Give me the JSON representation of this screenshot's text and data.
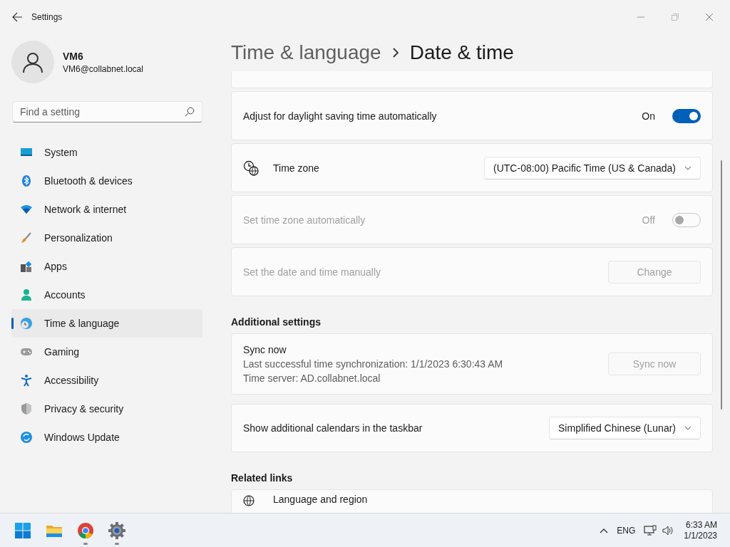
{
  "window": {
    "title": "Settings"
  },
  "account": {
    "name": "VM6",
    "email": "VM6@collabnet.local"
  },
  "search": {
    "placeholder": "Find a setting"
  },
  "nav": [
    {
      "label": "System",
      "kind": "system",
      "selected": false
    },
    {
      "label": "Bluetooth & devices",
      "kind": "bluetooth",
      "selected": false
    },
    {
      "label": "Network & internet",
      "kind": "network",
      "selected": false
    },
    {
      "label": "Personalization",
      "kind": "brush",
      "selected": false
    },
    {
      "label": "Apps",
      "kind": "apps",
      "selected": false
    },
    {
      "label": "Accounts",
      "kind": "accounts",
      "selected": false
    },
    {
      "label": "Time & language",
      "kind": "time",
      "selected": true
    },
    {
      "label": "Gaming",
      "kind": "gaming",
      "selected": false
    },
    {
      "label": "Accessibility",
      "kind": "accessibility",
      "selected": false
    },
    {
      "label": "Privacy & security",
      "kind": "privacy",
      "selected": false
    },
    {
      "label": "Windows Update",
      "kind": "update",
      "selected": false
    }
  ],
  "breadcrumb": {
    "parent": "Time & language",
    "current": "Date & time"
  },
  "settings": [
    {
      "kind": "toggle",
      "label": "Adjust for daylight saving time automatically",
      "state_label": "On",
      "on": true,
      "disabled": false
    },
    {
      "kind": "dropdown",
      "label": "Time zone",
      "value": "(UTC-08:00) Pacific Time (US & Canada)",
      "has_icon": true
    },
    {
      "kind": "toggle",
      "label": "Set time zone automatically",
      "state_label": "Off",
      "on": false,
      "disabled": true
    },
    {
      "kind": "button",
      "label": "Set the date and time manually",
      "button": "Change",
      "disabled": true
    }
  ],
  "additional_settings": {
    "heading": "Additional settings",
    "items": [
      {
        "kind": "sync",
        "title": "Sync now",
        "lines": [
          "Last successful time synchronization: 1/1/2023 6:30:43 AM",
          "Time server: AD.collabnet.local"
        ],
        "button": "Sync now",
        "disabled": true
      },
      {
        "kind": "dropdown",
        "label": "Show additional calendars in the taskbar",
        "value": "Simplified Chinese (Lunar)",
        "has_icon": false
      }
    ]
  },
  "related_links": {
    "heading": "Related links",
    "items": [
      {
        "label": "Language and region"
      }
    ]
  },
  "taskbar": {
    "apps": [
      {
        "kind": "start",
        "running": false
      },
      {
        "kind": "explorer",
        "running": false
      },
      {
        "kind": "chrome",
        "running": true
      },
      {
        "kind": "settings",
        "running": true
      }
    ],
    "language": "ENG",
    "time": "6:33 AM",
    "date": "1/1/2023"
  }
}
